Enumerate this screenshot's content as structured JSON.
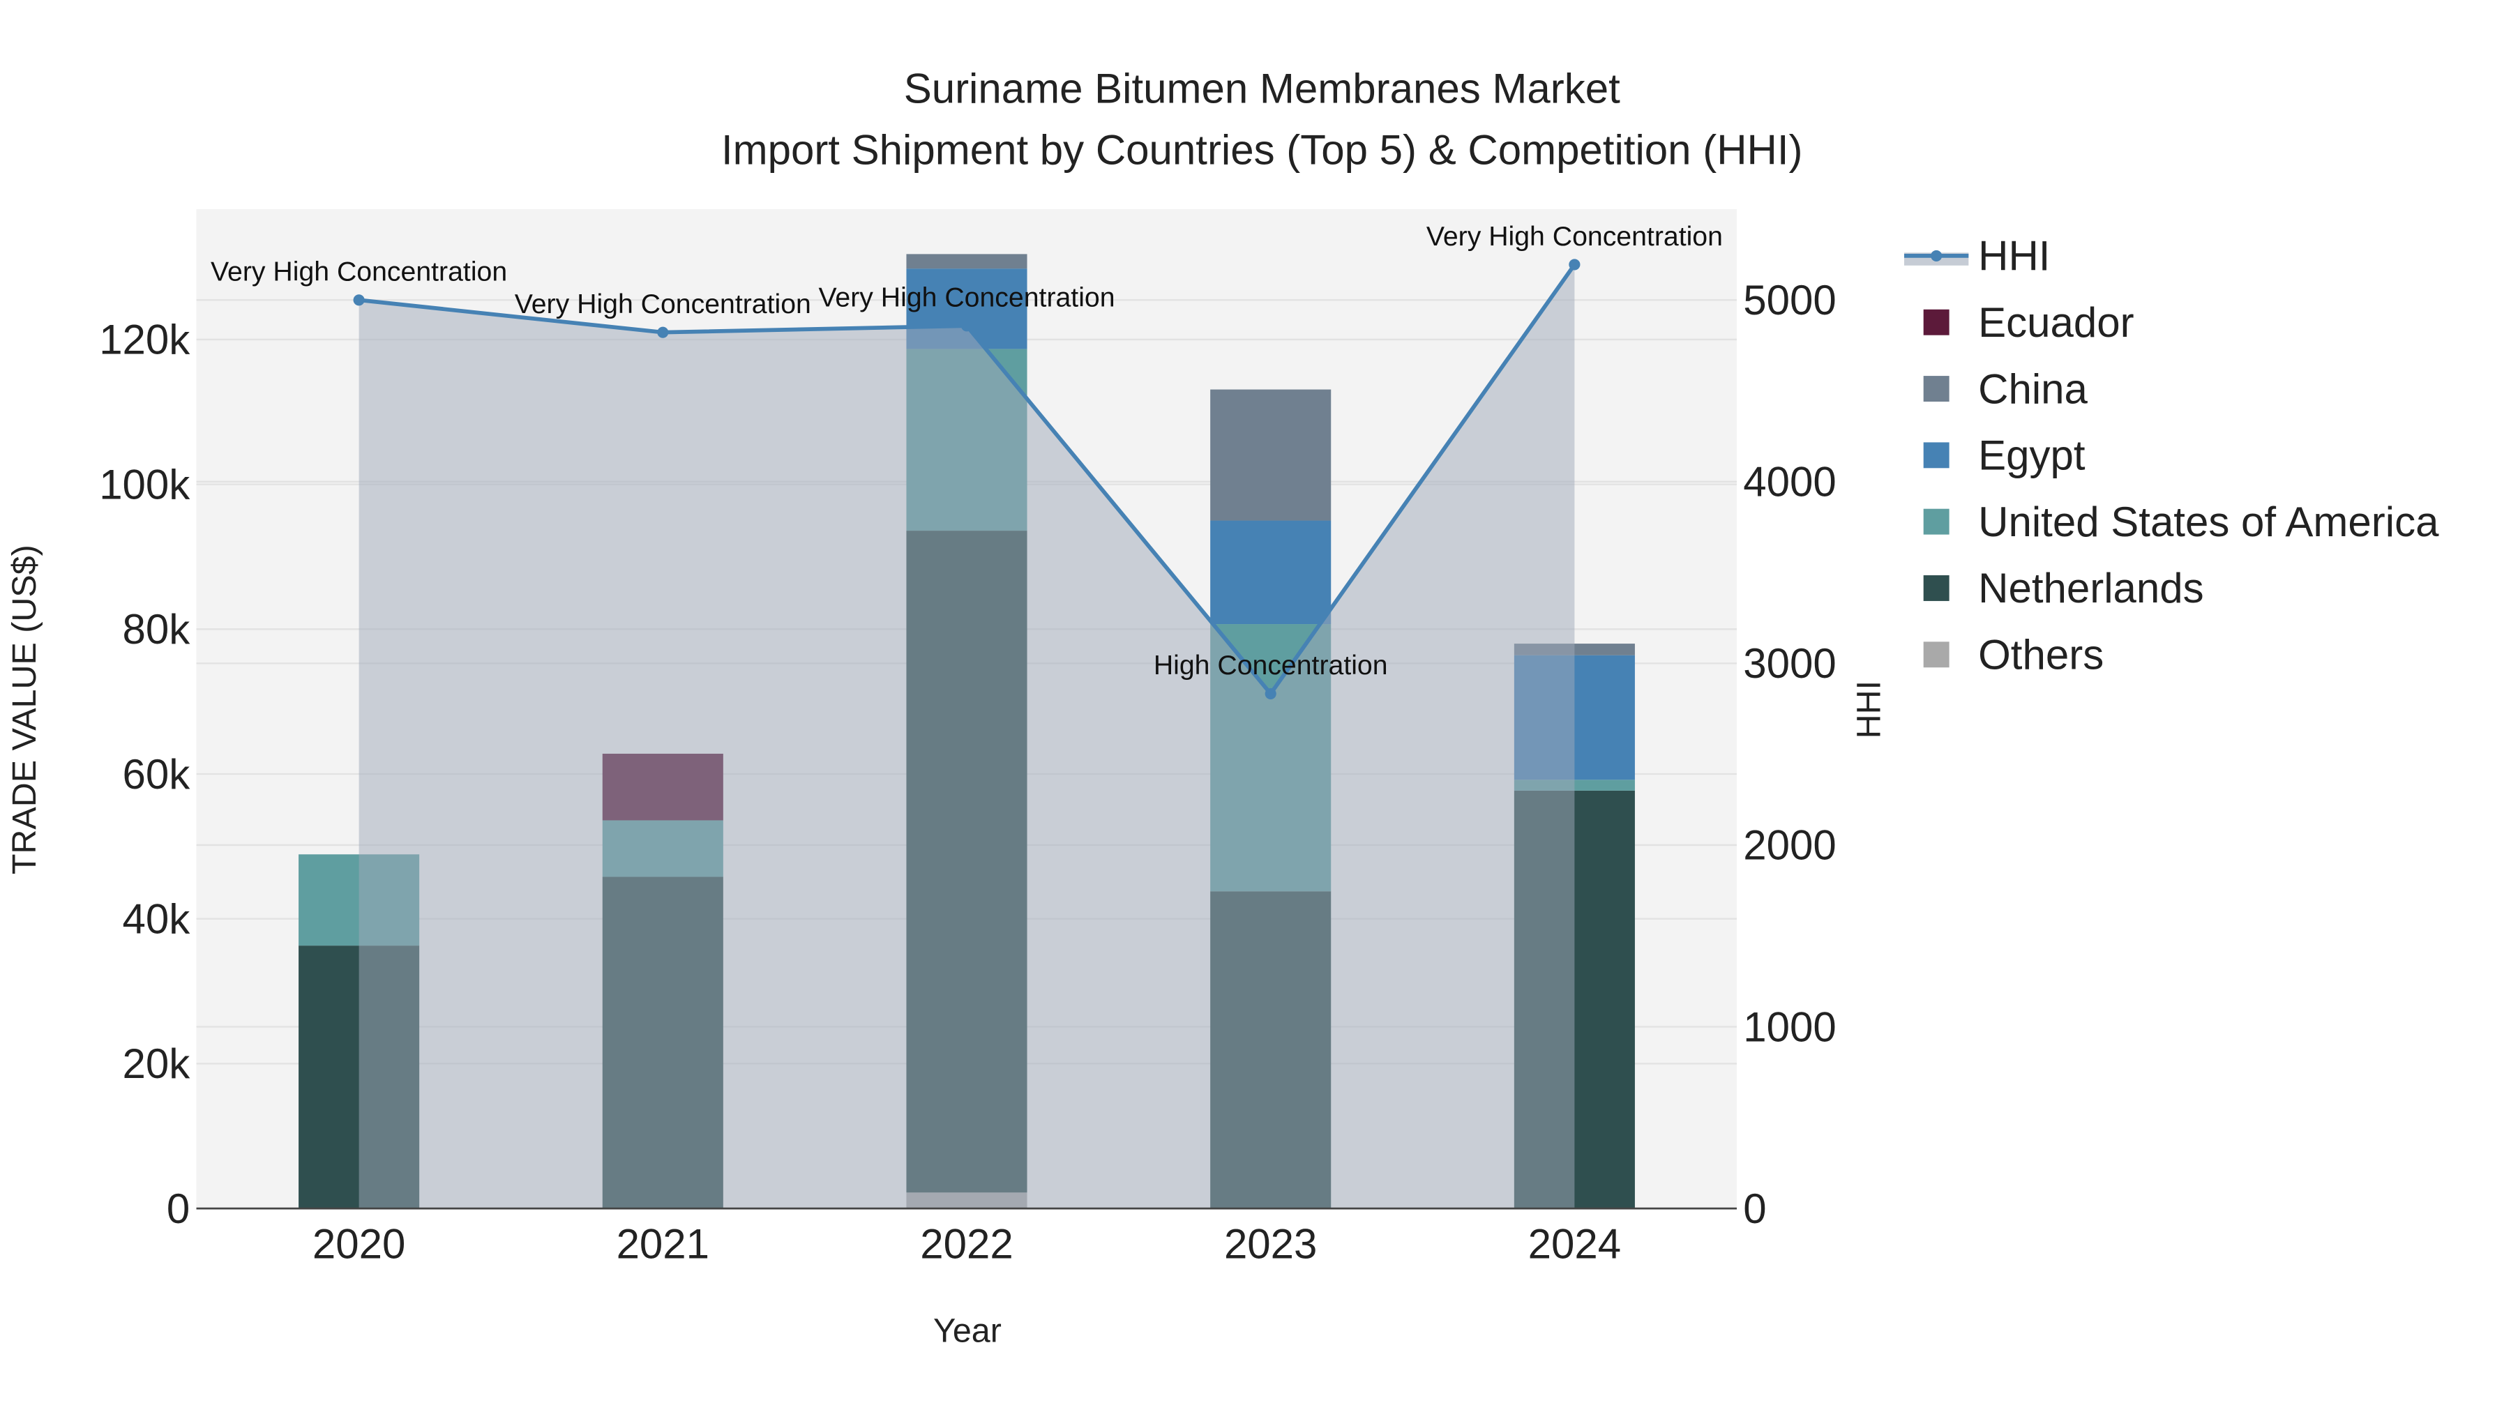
{
  "chart_data": {
    "type": "bar",
    "barmode": "stack",
    "title": "Suriname Bitumen Membranes Market",
    "subtitle": "Import Shipment by Countries (Top 5) & Competition (HHI)",
    "xlabel": "Year",
    "ylabel": "TRADE VALUE (US$)",
    "y2label": "HHI",
    "categories": [
      "2020",
      "2021",
      "2022",
      "2023",
      "2024"
    ],
    "ylim": [
      0,
      138000
    ],
    "y2lim": [
      0,
      5500
    ],
    "yticks": [
      0,
      20000,
      40000,
      60000,
      80000,
      100000,
      120000
    ],
    "ytick_labels": [
      "0",
      "20k",
      "40k",
      "60k",
      "80k",
      "100k",
      "120k"
    ],
    "y2ticks": [
      0,
      1000,
      2000,
      3000,
      4000,
      5000
    ],
    "y2tick_labels": [
      "0",
      "1000",
      "2000",
      "3000",
      "4000",
      "5000"
    ],
    "grid": true,
    "legend_position": "right",
    "series": [
      {
        "name": "Others",
        "color": "#a9a9a9",
        "values": [
          0,
          0,
          2200,
          0,
          0
        ]
      },
      {
        "name": "Netherlands",
        "color": "#2f4f4f",
        "values": [
          36300,
          45800,
          91400,
          43800,
          57700
        ]
      },
      {
        "name": "United States of America",
        "color": "#5f9ea0",
        "values": [
          12600,
          7800,
          25100,
          36900,
          1500
        ]
      },
      {
        "name": "Egypt",
        "color": "#4682b4",
        "values": [
          0,
          0,
          11100,
          14300,
          17200
        ]
      },
      {
        "name": "China",
        "color": "#708090",
        "values": [
          0,
          0,
          2000,
          18100,
          1600
        ]
      },
      {
        "name": "Ecuador",
        "color": "#5c1a3a",
        "values": [
          0,
          9200,
          0,
          0,
          0
        ]
      }
    ],
    "legend_order": [
      "HHI",
      "Ecuador",
      "China",
      "Egypt",
      "United States of America",
      "Netherlands",
      "Others"
    ],
    "hhi": {
      "name": "HHI",
      "color": "#4682b4",
      "values": [
        5000,
        4822,
        4858,
        2833,
        5195
      ],
      "annotations": [
        "Very High Concentration",
        "Very High Concentration",
        "Very High Concentration",
        "High Concentration",
        "Very High Concentration"
      ]
    }
  }
}
